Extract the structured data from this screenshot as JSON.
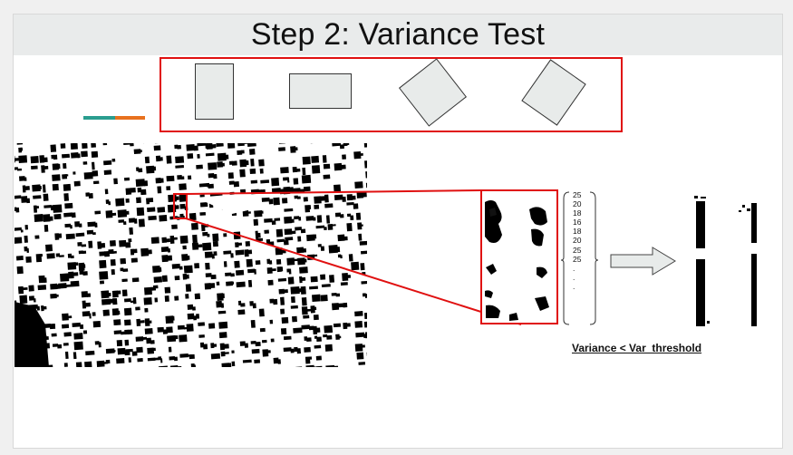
{
  "slide": {
    "title": "Step 2: Variance Test"
  },
  "legend": {
    "colors": [
      "#2a9d8f",
      "#e8711e"
    ]
  },
  "shapes": [
    "vertical-rectangle",
    "horizontal-rectangle",
    "rotated-rectangle-left",
    "rotated-rectangle-right"
  ],
  "variance_values": [
    "25",
    "20",
    "18",
    "16",
    "18",
    "20",
    "25",
    "25",
    ".",
    ".",
    "."
  ],
  "caption": "Variance < Var_threshold",
  "colors": {
    "highlight": "#e01010",
    "shape_fill": "#e8ebea",
    "title_bar": "#e9ebeb"
  }
}
